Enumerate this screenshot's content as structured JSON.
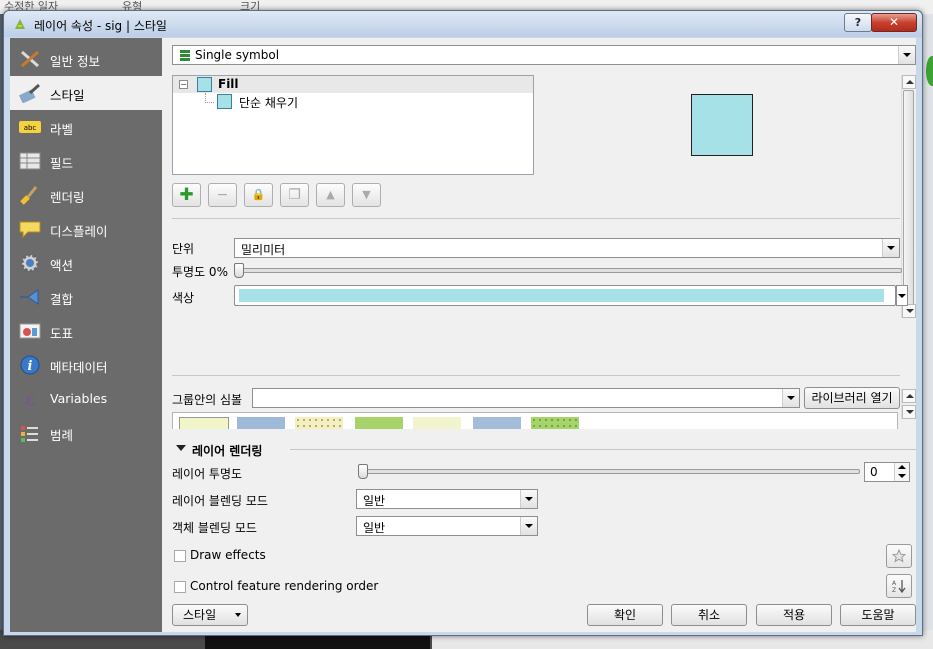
{
  "background": {
    "col1": "수정한 일자",
    "col2": "유형",
    "col3": "크기"
  },
  "window": {
    "title": "레이어 속성 - sig | 스타일",
    "help": "?",
    "close": "✕"
  },
  "sidebar": {
    "items": [
      {
        "label": "일반 정보",
        "icon": "tools-icon"
      },
      {
        "label": "스타일",
        "icon": "paintbrush-icon",
        "selected": true
      },
      {
        "label": "라벨",
        "icon": "abc-label-icon"
      },
      {
        "label": "필드",
        "icon": "table-icon"
      },
      {
        "label": "렌더링",
        "icon": "brush-icon"
      },
      {
        "label": "디스플레이",
        "icon": "speech-bubble-icon"
      },
      {
        "label": "액션",
        "icon": "gear-run-icon"
      },
      {
        "label": "결합",
        "icon": "join-icon"
      },
      {
        "label": "도표",
        "icon": "diagram-icon"
      },
      {
        "label": "메타데이터",
        "icon": "info-icon"
      },
      {
        "label": "Variables",
        "icon": "epsilon-icon"
      },
      {
        "label": "범례",
        "icon": "legend-icon"
      }
    ]
  },
  "renderer": {
    "selected": "Single symbol"
  },
  "symbol_tree": {
    "root": "Fill",
    "root_expand": "−",
    "child": "단순 채우기"
  },
  "toolbar": {
    "add": "✚",
    "remove": "−",
    "lock": "🔒",
    "duplicate": "❐",
    "up": "▲",
    "down": "▼"
  },
  "props": {
    "unit_label": "단위",
    "unit_value": "밀리미터",
    "opacity_label": "투명도 0%",
    "opacity_value": 0,
    "color_label": "색상",
    "fill_color": "#a6e1e8"
  },
  "group": {
    "label": "그룹안의 심볼",
    "value": "",
    "open_library": "라이브러리 열기"
  },
  "layer_rendering": {
    "header": "레이어 렌더링",
    "transparency_label": "레이어 투명도",
    "transparency_value": "0",
    "layer_blend_label": "레이어 블렌딩 모드",
    "layer_blend_value": "일반",
    "feature_blend_label": "객체 블렌딩 모드",
    "feature_blend_value": "일반",
    "draw_effects": "Draw effects",
    "feature_order": "Control feature rendering order"
  },
  "footer": {
    "style": "스타일",
    "ok": "확인",
    "cancel": "취소",
    "apply": "적용",
    "help": "도움말"
  }
}
